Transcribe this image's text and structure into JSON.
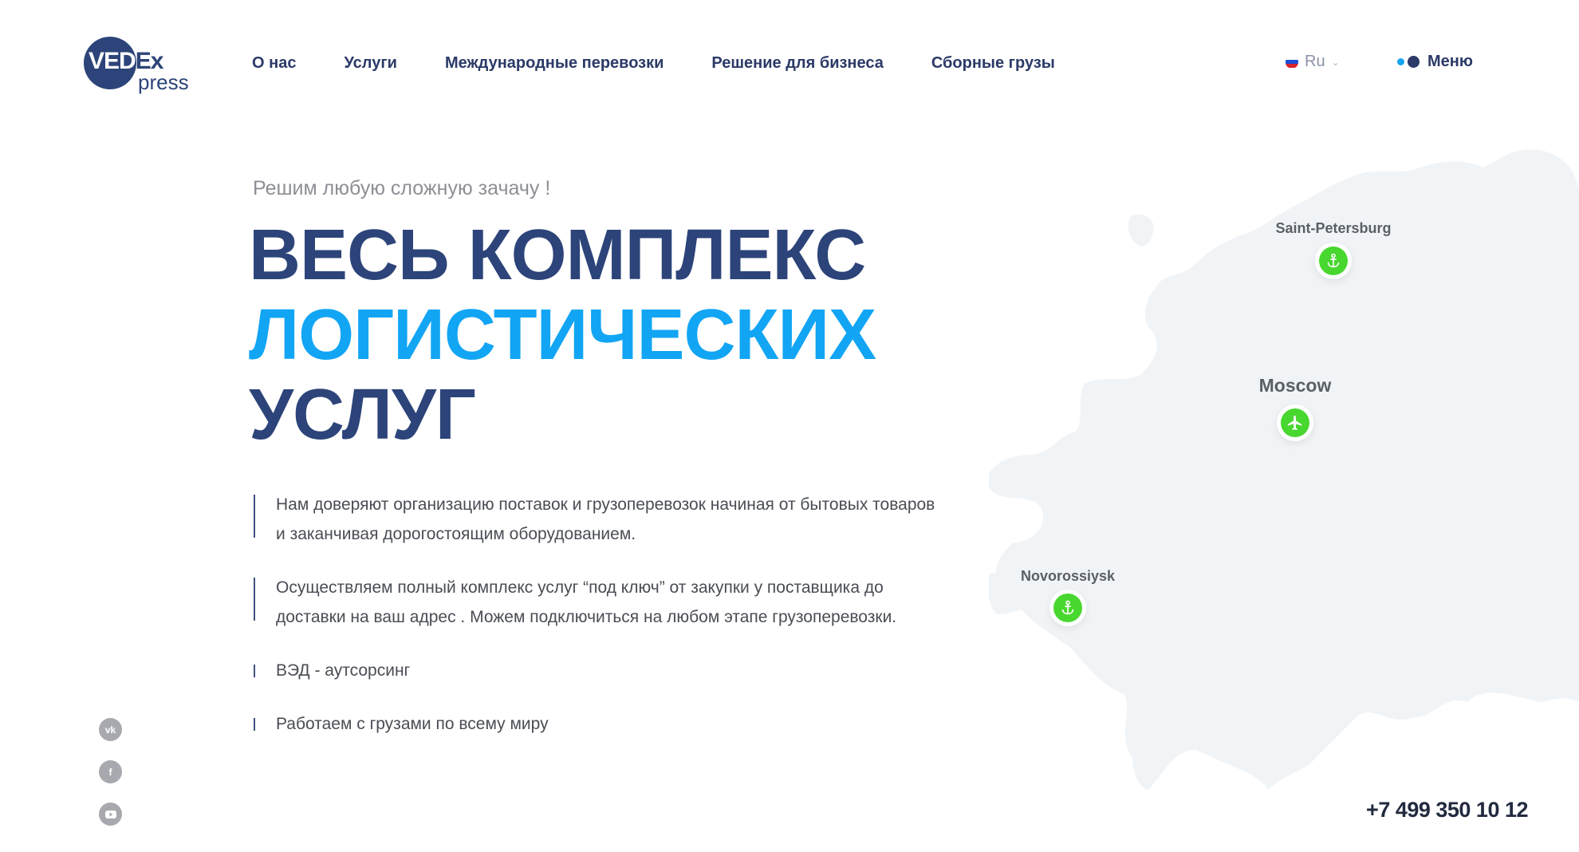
{
  "header": {
    "logo": {
      "main": "VEDEx",
      "sub": "press"
    },
    "nav": [
      "О нас",
      "Услуги",
      "Международные перевозки",
      "Решение для бизнеса",
      "Сборные грузы"
    ],
    "language": "Ru",
    "menu_label": "Меню"
  },
  "hero": {
    "subtitle": "Решим любую сложную зачачу !",
    "headline": {
      "line1": "ВЕСЬ КОМПЛЕКС",
      "line2": "ЛОГИСТИЧЕСКИХ",
      "line3": "УСЛУГ"
    },
    "bullets": [
      {
        "line1": "Нам доверяют организацию поставок и грузоперевозок начиная от бытовых товаров",
        "line2": "и заканчивая  дорогостоящим оборудованием."
      },
      {
        "line1": "Осуществляем полный комплекс услуг “под ключ” от закупки у поставщика до",
        "line2": "доставки на ваш адрес . Можем подключиться на любом этапе грузоперевозки."
      },
      {
        "line1": "ВЭД - аутсорсинг"
      },
      {
        "line1": "Работаем с грузами по всему миру"
      }
    ]
  },
  "map": {
    "cities": [
      {
        "name": "Saint-Petersburg",
        "icon": "anchor-icon"
      },
      {
        "name": "Moscow",
        "icon": "airplane-icon"
      },
      {
        "name": "Novorossiysk",
        "icon": "anchor-icon"
      }
    ]
  },
  "social": [
    "vk-icon",
    "facebook-icon",
    "youtube-icon"
  ],
  "phone": "+7 499 350 10 12",
  "colors": {
    "navy": "#2c4479",
    "accent_blue": "#12a5f4",
    "pin_green": "#48d72e",
    "map_fill": "#f1f4f7"
  }
}
